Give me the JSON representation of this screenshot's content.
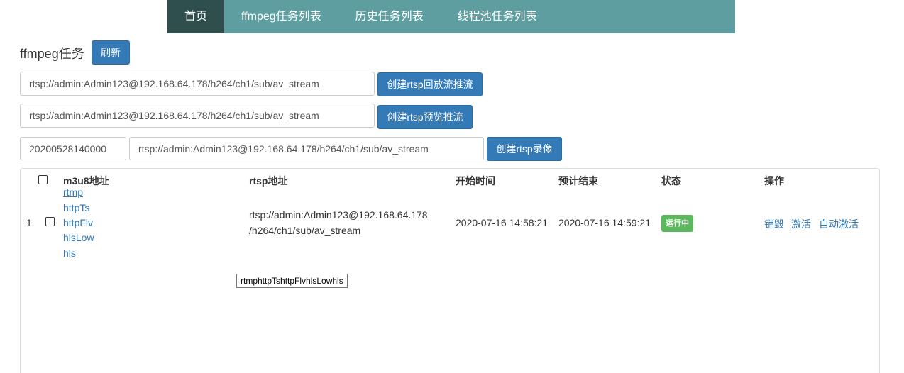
{
  "nav": {
    "items": [
      {
        "label": "首页"
      },
      {
        "label": "ffmpeg任务列表"
      },
      {
        "label": "历史任务列表"
      },
      {
        "label": "线程池任务列表"
      }
    ]
  },
  "page": {
    "title": "ffmpeg任务",
    "refresh_label": "刷新"
  },
  "form": {
    "playback_url": "rtsp://admin:Admin123@192.168.64.178/h264/ch1/sub/av_stream",
    "playback_button": "创建rtsp回放流推流",
    "preview_url": "rtsp://admin:Admin123@192.168.64.178/h264/ch1/sub/av_stream",
    "preview_button": "创建rtsp预览推流",
    "record_time": "20200528140000",
    "record_url": "rtsp://admin:Admin123@192.168.64.178/h264/ch1/sub/av_stream",
    "record_button": "创建rtsp录像"
  },
  "table": {
    "headers": {
      "m3u8": "m3u8地址",
      "rtsp": "rtsp地址",
      "start": "开始时间",
      "end": "预计结束",
      "status": "状态",
      "actions": "操作"
    },
    "rows": [
      {
        "index": "1",
        "links": [
          "rtmp",
          "httpTs",
          "httpFlv",
          "hlsLow",
          "hls"
        ],
        "rtsp_line1": "rtsp://admin:Admin123@192.168.64.178",
        "rtsp_line2": "/h264/ch1/sub/av_stream",
        "start": "2020-07-16 14:58:21",
        "end": "2020-07-16 14:59:21",
        "status": "运行中",
        "status_color": "#5cb85c",
        "actions": [
          "销毁",
          "激活",
          "自动激活"
        ]
      }
    ]
  },
  "tooltip": {
    "text": "rtmphttpTshttpFlvhlsLowhls"
  }
}
